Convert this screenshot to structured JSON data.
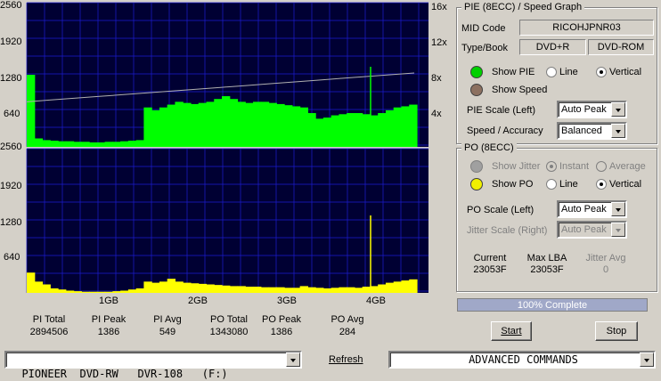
{
  "graph": {
    "pie_left_ticks": [
      "2560",
      "1920",
      "1280",
      "640"
    ],
    "po_left_ticks": [
      "2560",
      "1920",
      "1280",
      "640"
    ],
    "speed_ticks": [
      "16x",
      "12x",
      "8x",
      "4x"
    ],
    "x_ticks": [
      "1GB",
      "2GB",
      "3GB",
      "4GB"
    ],
    "colors": {
      "bg": "#000033",
      "grid": "#1c1cd0",
      "pie": "#00ff00",
      "po": "#ffff00",
      "speed": "#b0b0b0"
    }
  },
  "chart_data": [
    {
      "type": "area",
      "series": [
        {
          "name": "PIE",
          "values": [
            1280,
            150,
            120,
            110,
            100,
            100,
            90,
            90,
            80,
            80,
            90,
            90,
            100,
            110,
            120,
            700,
            650,
            700,
            750,
            800,
            780,
            760,
            780,
            800,
            850,
            900,
            850,
            800,
            780,
            800,
            800,
            780,
            760,
            740,
            720,
            700,
            600,
            500,
            520,
            560,
            580,
            600,
            600,
            580,
            560,
            600,
            650,
            700,
            720,
            750
          ]
        }
      ],
      "x_range_gb": [
        0,
        4.4
      ],
      "ylim": [
        0,
        2560
      ]
    },
    {
      "type": "line",
      "series": [
        {
          "name": "Speed",
          "values": [
            5.0,
            5.2,
            5.4,
            5.6,
            5.8,
            6.0,
            6.2,
            6.4,
            6.6,
            6.8,
            7.0,
            7.2,
            7.4,
            7.6,
            7.8,
            8.0,
            8.2
          ]
        }
      ],
      "ylim": [
        0,
        16
      ]
    },
    {
      "type": "area",
      "series": [
        {
          "name": "PO",
          "values": [
            360,
            200,
            150,
            80,
            60,
            40,
            30,
            20,
            20,
            20,
            20,
            30,
            40,
            60,
            80,
            200,
            180,
            200,
            250,
            200,
            180,
            170,
            160,
            150,
            140,
            130,
            120,
            120,
            110,
            110,
            100,
            100,
            100,
            90,
            90,
            120,
            100,
            90,
            80,
            90,
            100,
            100,
            90,
            110,
            120,
            150,
            180,
            200,
            220,
            240
          ]
        }
      ],
      "x_range_gb": [
        0,
        4.4
      ],
      "ylim": [
        0,
        2560
      ]
    }
  ],
  "pie_group": {
    "title": "PIE (8ECC) / Speed Graph",
    "mid_label": "MID Code",
    "mid_value": "RICOHJPNR03",
    "typebook_label": "Type/Book",
    "type_value": "DVD+R",
    "book_value": "DVD-ROM",
    "show_pie": "Show PIE",
    "line": "Line",
    "vertical": "Vertical",
    "show_speed": "Show Speed",
    "pie_scale_label": "PIE Scale (Left)",
    "pie_scale_value": "Auto Peak",
    "speed_acc_label": "Speed / Accuracy",
    "speed_acc_value": "Balanced",
    "pie_color": "#00d000",
    "speed_color": "#8c7060"
  },
  "po_group": {
    "title": "PO (8ECC)",
    "show_jitter": "Show Jitter",
    "instant": "Instant",
    "average": "Average",
    "show_po": "Show PO",
    "line": "Line",
    "vertical": "Vertical",
    "po_scale_label": "PO Scale (Left)",
    "po_scale_value": "Auto Peak",
    "jitter_scale_label": "Jitter Scale (Right)",
    "jitter_scale_value": "Auto Peak",
    "current_label": "Current",
    "current_value": "23053F",
    "maxlba_label": "Max LBA",
    "maxlba_value": "23053F",
    "jitter_avg_label": "Jitter Avg",
    "jitter_avg_value": "0",
    "po_color": "#f0f000",
    "jitter_color": "#a0a0a0"
  },
  "progress": {
    "text": "100% Complete",
    "fraction": 1.0
  },
  "stats": [
    {
      "label": "PI Total",
      "value": "2894506"
    },
    {
      "label": "PI Peak",
      "value": "1386"
    },
    {
      "label": "PI Avg",
      "value": "549"
    },
    {
      "label": "PO Total",
      "value": "1343080"
    },
    {
      "label": "PO Peak",
      "value": "1386"
    },
    {
      "label": "PO Avg",
      "value": "284"
    }
  ],
  "buttons": {
    "start": "Start",
    "stop": "Stop",
    "refresh": "Refresh"
  },
  "drive": {
    "value": "PIONEER  DVD-RW   DVR-108   (F:)"
  },
  "commands": {
    "value": "ADVANCED COMMANDS"
  }
}
